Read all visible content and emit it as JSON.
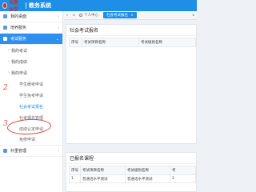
{
  "header": {
    "logo_text": "长春大学",
    "app_title": "教务系统"
  },
  "tabs": {
    "prev": "«",
    "back": "◂",
    "home": "个人中心",
    "active": "社会考试报名",
    "close": "×",
    "forward": "▸"
  },
  "sidebar": {
    "groups": [
      {
        "label": "我的桌面"
      },
      {
        "label": "培养服务"
      },
      {
        "label": "考试服务"
      }
    ],
    "items": [
      {
        "label": "我的考试"
      },
      {
        "label": "我的成绩"
      },
      {
        "label": "我的申请"
      }
    ],
    "subs": [
      {
        "label": "学生缓考申请"
      },
      {
        "label": "学生免考申请"
      },
      {
        "label": "社会考试报名"
      },
      {
        "label": "社考报名管理"
      },
      {
        "label": "成绩认定申请"
      },
      {
        "label": "免修申请"
      }
    ],
    "group_bottom": {
      "label": "补重管理"
    },
    "annotations": {
      "two": "2",
      "three": "3"
    }
  },
  "panel_register": {
    "title": "社会考试报名",
    "columns": [
      "序号",
      "考试项目名称",
      "考试级别名称"
    ]
  },
  "panel_registered": {
    "title": "已报名课程",
    "columns": [
      "序号",
      "考试项目名称",
      "考试级别名称",
      "考"
    ],
    "rows": [
      [
        "1",
        "普通话水平测试",
        "普通话水平测试",
        "2"
      ]
    ]
  },
  "colors": {
    "header": "#1e8ee6",
    "active_nav": "#2d8ff0",
    "annotation": "#e0483e"
  }
}
